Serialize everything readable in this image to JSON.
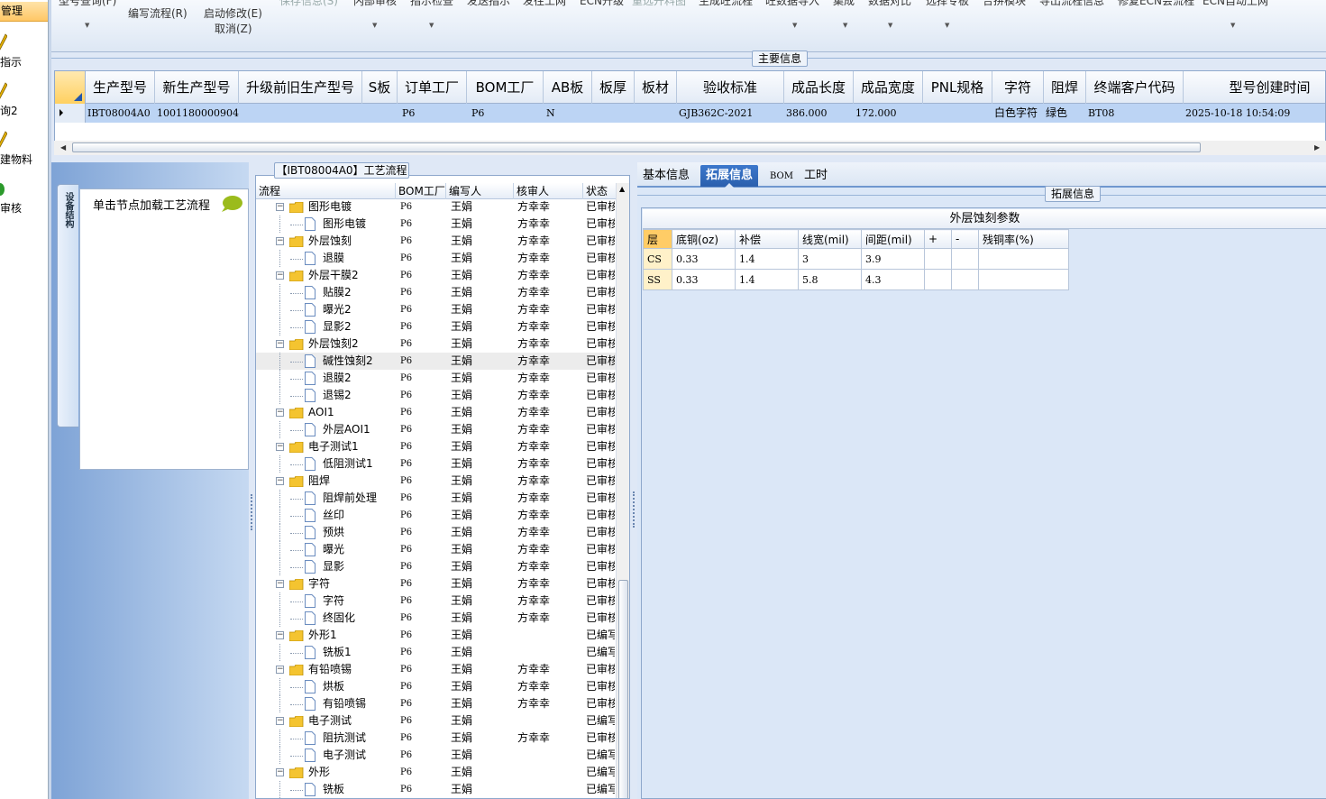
{
  "leftnav": {
    "active": "管理",
    "items": [
      {
        "label": "指示"
      },
      {
        "label": "询2"
      },
      {
        "label": "建物料"
      },
      {
        "label": "审核"
      }
    ]
  },
  "toolbar": {
    "row1": [
      {
        "label": "型号查询(F)"
      },
      {
        "label": "保存信息(S)"
      },
      {
        "label": "内部审核"
      },
      {
        "label": "指示检查"
      },
      {
        "label": "发送指示"
      },
      {
        "label": "发往工网"
      },
      {
        "label": "ECN升级"
      },
      {
        "label": "重选开料图"
      },
      {
        "label": "生成旺流程"
      },
      {
        "label": "旺数据导入"
      },
      {
        "label": "集成"
      },
      {
        "label": "数据对比"
      },
      {
        "label": "选择专板"
      },
      {
        "label": "合拼模块"
      },
      {
        "label": "导出流程信息"
      },
      {
        "label": "修复ECN会流程"
      },
      {
        "label": "ECN自动上网"
      }
    ],
    "edit_flow": "编写流程(R)",
    "start_edit": "启动修改(E)",
    "cancel": "取消(Z)"
  },
  "main_info": {
    "title": "主要信息",
    "columns": [
      "生产型号",
      "新生产型号",
      "升级前旧生产型号",
      "S板",
      "订单工厂",
      "BOM工厂",
      "AB板",
      "板厚",
      "板材",
      "验收标准",
      "成品长度",
      "成品宽度",
      "PNL规格",
      "字符",
      "阻焊",
      "终端客户代码",
      "型号创建时间"
    ],
    "row": [
      "IBT08004A0",
      "10011800009046",
      "",
      "",
      "P6",
      "P6",
      "N",
      "",
      "",
      "GJB362C-2021",
      "386.000",
      "172.000",
      "",
      "白色字符",
      "绿色",
      "BT08",
      "2025-10-18 10:54:09"
    ]
  },
  "left_tabs": {
    "vertical_tab": "设备结构",
    "hint": "单击节点加载工艺流程"
  },
  "flow": {
    "title": "【IBT08004A0】工艺流程",
    "columns": [
      "流程",
      "BOM工厂",
      "编写人",
      "核审人",
      "状态"
    ],
    "rows": [
      {
        "level": 1,
        "name": "图形电镀",
        "bom": "P6",
        "writer": "王娟",
        "reviewer": "方幸幸",
        "status": "已审核"
      },
      {
        "level": 2,
        "name": "图形电镀",
        "bom": "P6",
        "writer": "王娟",
        "reviewer": "方幸幸",
        "status": "已审核"
      },
      {
        "level": 1,
        "name": "外层蚀刻",
        "bom": "P6",
        "writer": "王娟",
        "reviewer": "方幸幸",
        "status": "已审核"
      },
      {
        "level": 2,
        "name": "退膜",
        "bom": "P6",
        "writer": "王娟",
        "reviewer": "方幸幸",
        "status": "已审核"
      },
      {
        "level": 1,
        "name": "外层干膜2",
        "bom": "P6",
        "writer": "王娟",
        "reviewer": "方幸幸",
        "status": "已审核"
      },
      {
        "level": 2,
        "name": "贴膜2",
        "bom": "P6",
        "writer": "王娟",
        "reviewer": "方幸幸",
        "status": "已审核"
      },
      {
        "level": 2,
        "name": "曝光2",
        "bom": "P6",
        "writer": "王娟",
        "reviewer": "方幸幸",
        "status": "已审核"
      },
      {
        "level": 2,
        "name": "显影2",
        "bom": "P6",
        "writer": "王娟",
        "reviewer": "方幸幸",
        "status": "已审核"
      },
      {
        "level": 1,
        "name": "外层蚀刻2",
        "bom": "P6",
        "writer": "王娟",
        "reviewer": "方幸幸",
        "status": "已审核"
      },
      {
        "level": 2,
        "name": "碱性蚀刻2",
        "bom": "P6",
        "writer": "王娟",
        "reviewer": "方幸幸",
        "status": "已审核",
        "selected": true
      },
      {
        "level": 2,
        "name": "退膜2",
        "bom": "P6",
        "writer": "王娟",
        "reviewer": "方幸幸",
        "status": "已审核"
      },
      {
        "level": 2,
        "name": "退锡2",
        "bom": "P6",
        "writer": "王娟",
        "reviewer": "方幸幸",
        "status": "已审核"
      },
      {
        "level": 1,
        "name": "AOI1",
        "bom": "P6",
        "writer": "王娟",
        "reviewer": "方幸幸",
        "status": "已审核"
      },
      {
        "level": 2,
        "name": "外层AOI1",
        "bom": "P6",
        "writer": "王娟",
        "reviewer": "方幸幸",
        "status": "已审核"
      },
      {
        "level": 1,
        "name": "电子测试1",
        "bom": "P6",
        "writer": "王娟",
        "reviewer": "方幸幸",
        "status": "已审核"
      },
      {
        "level": 2,
        "name": "低阻测试1",
        "bom": "P6",
        "writer": "王娟",
        "reviewer": "方幸幸",
        "status": "已审核"
      },
      {
        "level": 1,
        "name": "阻焊",
        "bom": "P6",
        "writer": "王娟",
        "reviewer": "方幸幸",
        "status": "已审核"
      },
      {
        "level": 2,
        "name": "阻焊前处理",
        "bom": "P6",
        "writer": "王娟",
        "reviewer": "方幸幸",
        "status": "已审核"
      },
      {
        "level": 2,
        "name": "丝印",
        "bom": "P6",
        "writer": "王娟",
        "reviewer": "方幸幸",
        "status": "已审核"
      },
      {
        "level": 2,
        "name": "预烘",
        "bom": "P6",
        "writer": "王娟",
        "reviewer": "方幸幸",
        "status": "已审核"
      },
      {
        "level": 2,
        "name": "曝光",
        "bom": "P6",
        "writer": "王娟",
        "reviewer": "方幸幸",
        "status": "已审核"
      },
      {
        "level": 2,
        "name": "显影",
        "bom": "P6",
        "writer": "王娟",
        "reviewer": "方幸幸",
        "status": "已审核"
      },
      {
        "level": 1,
        "name": "字符",
        "bom": "P6",
        "writer": "王娟",
        "reviewer": "方幸幸",
        "status": "已审核"
      },
      {
        "level": 2,
        "name": "字符",
        "bom": "P6",
        "writer": "王娟",
        "reviewer": "方幸幸",
        "status": "已审核"
      },
      {
        "level": 2,
        "name": "终固化",
        "bom": "P6",
        "writer": "王娟",
        "reviewer": "方幸幸",
        "status": "已审核"
      },
      {
        "level": 1,
        "name": "外形1",
        "bom": "P6",
        "writer": "王娟",
        "reviewer": "",
        "status": "已编写"
      },
      {
        "level": 2,
        "name": "铣板1",
        "bom": "P6",
        "writer": "王娟",
        "reviewer": "",
        "status": "已编写"
      },
      {
        "level": 1,
        "name": "有铅喷锡",
        "bom": "P6",
        "writer": "王娟",
        "reviewer": "方幸幸",
        "status": "已审核"
      },
      {
        "level": 2,
        "name": "烘板",
        "bom": "P6",
        "writer": "王娟",
        "reviewer": "方幸幸",
        "status": "已审核"
      },
      {
        "level": 2,
        "name": "有铅喷锡",
        "bom": "P6",
        "writer": "王娟",
        "reviewer": "方幸幸",
        "status": "已审核"
      },
      {
        "level": 1,
        "name": "电子测试",
        "bom": "P6",
        "writer": "王娟",
        "reviewer": "",
        "status": "已编写"
      },
      {
        "level": 2,
        "name": "阻抗测试",
        "bom": "P6",
        "writer": "王娟",
        "reviewer": "方幸幸",
        "status": "已审核"
      },
      {
        "level": 2,
        "name": "电子测试",
        "bom": "P6",
        "writer": "王娟",
        "reviewer": "",
        "status": "已编写"
      },
      {
        "level": 1,
        "name": "外形",
        "bom": "P6",
        "writer": "王娟",
        "reviewer": "",
        "status": "已编写"
      },
      {
        "level": 2,
        "name": "铣板",
        "bom": "P6",
        "writer": "王娟",
        "reviewer": "",
        "status": "已编写"
      }
    ]
  },
  "right_tabs": [
    {
      "label": "基本信息"
    },
    {
      "label": "拓展信息",
      "active": true
    },
    {
      "label": "BOM"
    },
    {
      "label": "工时"
    }
  ],
  "ext": {
    "group_title": "拓展信息",
    "caption": "外层蚀刻参数",
    "columns": [
      "层",
      "底铜(oz)",
      "补偿",
      "线宽(mil)",
      "间距(mil)",
      "+",
      "-",
      "残铜率(%)"
    ],
    "rows": [
      [
        "CS",
        "0.33",
        "1.4",
        "3",
        "3.9",
        "",
        "",
        ""
      ],
      [
        "SS",
        "0.33",
        "1.4",
        "5.8",
        "4.3",
        "",
        "",
        ""
      ]
    ]
  },
  "colors": {
    "accent": "#2a5fad",
    "selected_row": "#bcd4f4",
    "header_gold": "#ffcc66"
  }
}
